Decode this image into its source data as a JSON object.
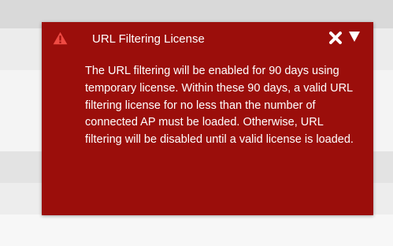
{
  "notification": {
    "title": "URL Filtering License",
    "icons": {
      "warning": "warning-triangle-icon",
      "close": "close-x-icon",
      "collapse": "triangle-down-icon"
    },
    "message": "The URL filtering will be enabled for 90 days using temporary license. Within these 90 days, a valid URL filtering license for no less than the number of connected AP must be loaded. Otherwise, URL filtering will be disabled until a valid license is loaded.",
    "colors": {
      "background": "#9b0e0b",
      "warning_icon": "#ef4a43",
      "text": "#ffffff"
    }
  }
}
